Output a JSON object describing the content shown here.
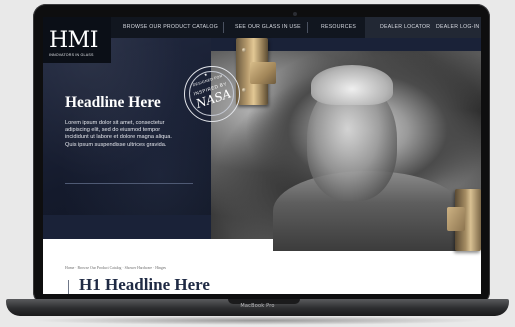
{
  "device": {
    "label": "MacBook Pro"
  },
  "nav": {
    "items": [
      {
        "label": "BROWSE OUR PRODUCT CATALOG"
      },
      {
        "label": "SEE OUR GLASS IN USE"
      },
      {
        "label": "RESOURCES"
      },
      {
        "label": "DEALER LOCATOR"
      },
      {
        "label": "DEALER LOG-IN"
      }
    ]
  },
  "logo": {
    "mark": "HMI",
    "tagline": "INNOVATORS IN GLASS"
  },
  "hero": {
    "headline": "Headline Here",
    "body": "Lorem ipsum dolor sit amet, consectetur adipiscing elit, sed do eiusmod tempor incididunt ut labore et dolore magna aliqua. Quis ipsum suspendisse ultrices gravida."
  },
  "badge": {
    "top": "DESIGNED FOR",
    "mid": "INSPIRED BY",
    "main": "NASA"
  },
  "breadcrumb": "Home · Browse Our Product Catalog · Shower Hardware · Hinges",
  "page_heading": "H1 Headline Here",
  "colors": {
    "nav_bg": "#11161f",
    "hero_bg": "#1a2238",
    "heading": "#1f2a44"
  }
}
